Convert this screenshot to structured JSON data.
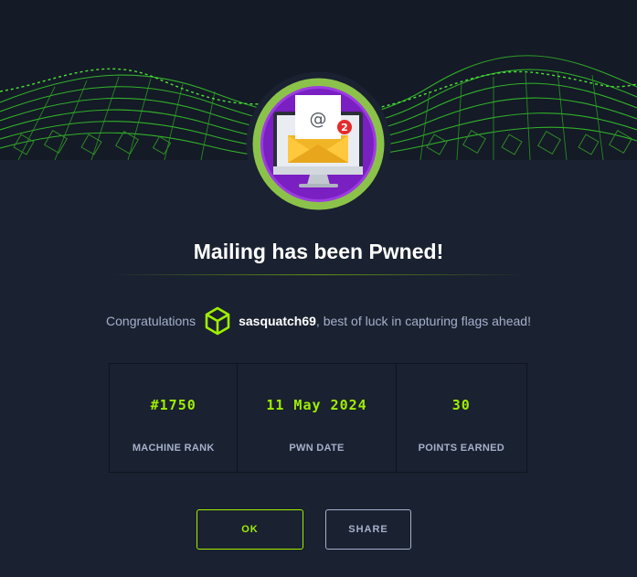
{
  "header": {
    "banner_image": "green-wireframe-wave-banner",
    "machine_avatar": "mailing-envelope-badge",
    "notification_count": "2",
    "envelope_symbol": "@"
  },
  "title": "Mailing has been Pwned!",
  "congrats": {
    "prefix": "Congratulations",
    "user_icon": "green-cube-icon",
    "username": "sasquatch69",
    "suffix": ", best of luck in capturing flags ahead!"
  },
  "stats": [
    {
      "value": "#1750",
      "label": "MACHINE RANK"
    },
    {
      "value": "11 May 2024",
      "label": "PWN DATE"
    },
    {
      "value": "30",
      "label": "POINTS EARNED"
    }
  ],
  "buttons": {
    "ok": "OK",
    "share": "SHARE"
  },
  "colors": {
    "background": "#1a2130",
    "accent": "#9fef00",
    "muted_text": "#a4b1cd",
    "avatar_ring": "#8bc34a",
    "avatar_fill": "#7a1fc2"
  }
}
